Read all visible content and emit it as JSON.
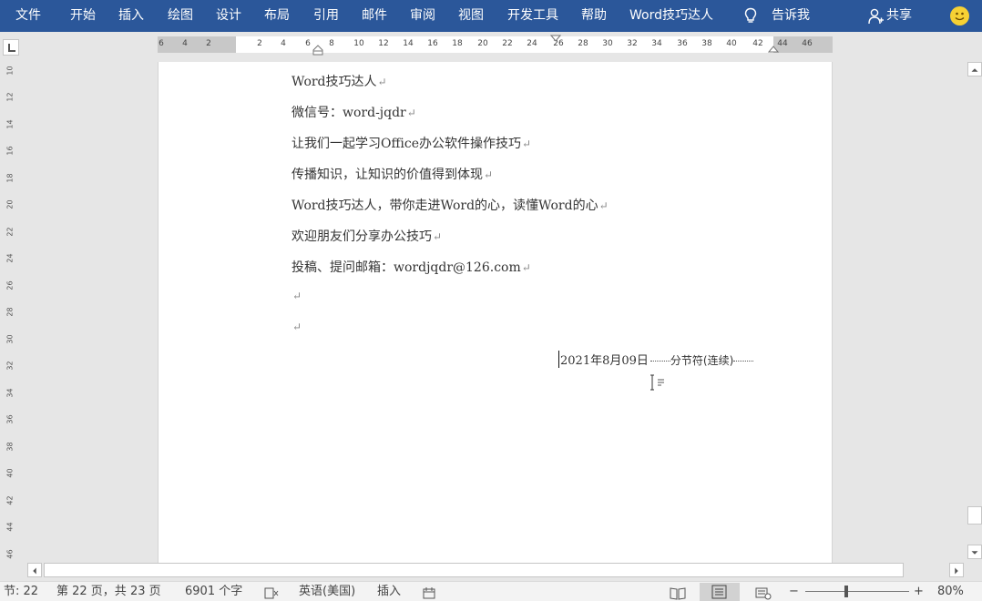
{
  "ribbon": {
    "tabs": [
      "文件",
      "开始",
      "插入",
      "绘图",
      "设计",
      "布局",
      "引用",
      "邮件",
      "审阅",
      "视图",
      "开发工具",
      "帮助",
      "Word技巧达人"
    ],
    "tell_me": "告诉我",
    "share": "共享",
    "background_color": "#2b579a"
  },
  "ruler": {
    "left_numbers": [
      "6",
      "4",
      "2"
    ],
    "numbers": [
      "2",
      "4",
      "6",
      "8",
      "10",
      "12",
      "14",
      "16",
      "18",
      "20",
      "22",
      "24",
      "26",
      "28",
      "30",
      "32",
      "34",
      "36",
      "38",
      "40",
      "42",
      "44",
      "46"
    ],
    "vertical_numbers": [
      "10",
      "12",
      "14",
      "16",
      "18",
      "20",
      "22",
      "24",
      "26",
      "28",
      "30",
      "32",
      "34",
      "36",
      "38",
      "40",
      "42",
      "44",
      "46"
    ]
  },
  "document": {
    "lines": [
      "Word技巧达人",
      "微信号：word-jqdr",
      "让我们一起学习Office办公软件操作技巧",
      "传播知识，让知识的价值得到体现",
      "Word技巧达人，带你走进Word的心，读懂Word的心",
      "欢迎朋友们分享办公技巧",
      "投稿、提问邮箱：wordjqdr@126.com",
      "",
      ""
    ],
    "paragraph_mark": "↵",
    "date_text": "2021年8月09日",
    "section_break": "分节符(连续)"
  },
  "status": {
    "section": "节: 22",
    "page": "第 22 页，共 23 页",
    "words": "6901 个字",
    "language": "英语(美国)",
    "mode": "插入",
    "zoom": "80%",
    "zoom_minus": "−",
    "zoom_plus": "+"
  }
}
